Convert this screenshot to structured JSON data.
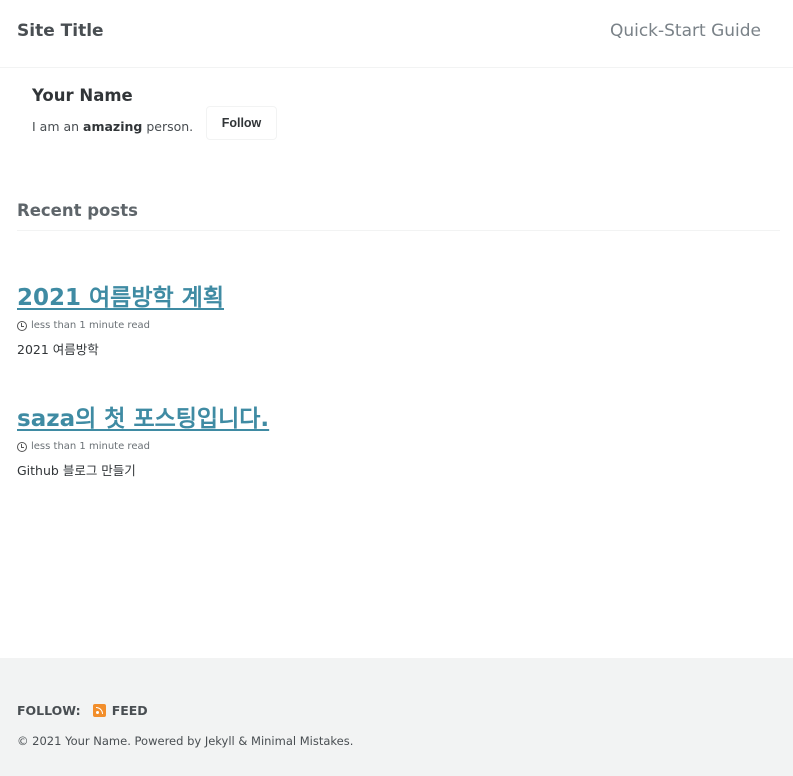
{
  "masthead": {
    "site_title": "Site Title",
    "nav_item": "Quick-Start Guide"
  },
  "author": {
    "name": "Your Name",
    "bio_prefix": "I am an ",
    "bio_emphasis": "amazing",
    "bio_suffix": " person.",
    "follow_label": "Follow"
  },
  "recent": {
    "heading": "Recent posts",
    "posts": [
      {
        "title": "2021 여름방학 계획",
        "read_time": "less than 1 minute read",
        "excerpt": "2021 여름방학"
      },
      {
        "title": "saza의 첫 포스팅입니다.",
        "read_time": "less than 1 minute read",
        "excerpt": "Github 블로그 만들기"
      }
    ]
  },
  "footer": {
    "follow_label": "FOLLOW:",
    "feed_label": "FEED",
    "copyright": "© 2021 Your Name. Powered by Jekyll & Minimal Mistakes."
  },
  "colors": {
    "link": "#3f8ba3",
    "footer_bg": "#f2f3f3",
    "rss": "#f28e2b"
  }
}
